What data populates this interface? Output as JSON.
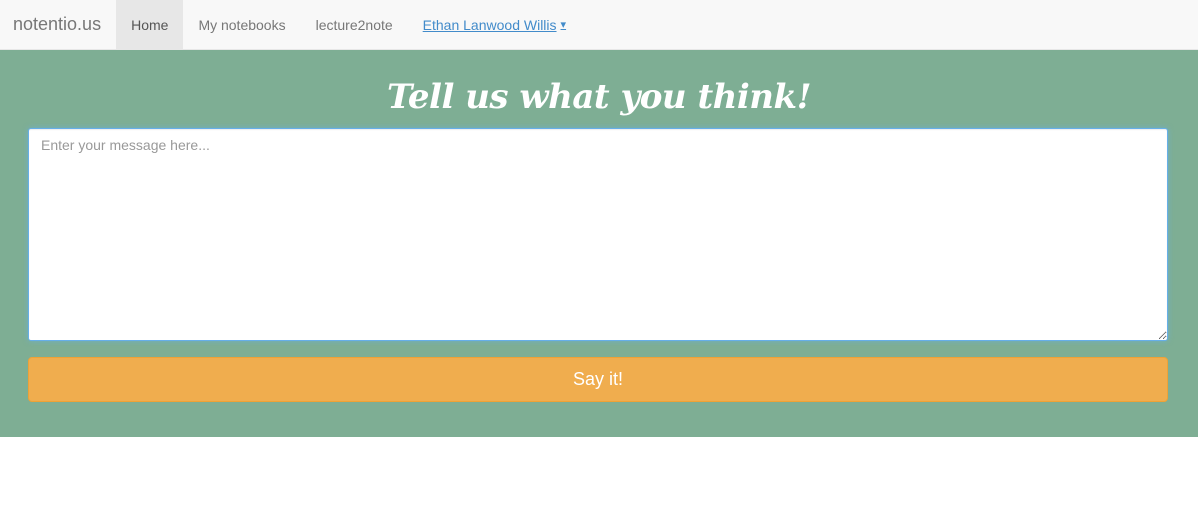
{
  "navbar": {
    "brand": "notentio.us",
    "items": [
      {
        "label": "Home",
        "active": true
      },
      {
        "label": "My notebooks",
        "active": false
      },
      {
        "label": "lecture2note",
        "active": false
      }
    ],
    "user": {
      "label": "Ethan Lanwood Willis",
      "caret": "▾"
    }
  },
  "hero": {
    "title": "Tell us what you think!",
    "message_placeholder": "Enter your message here...",
    "message_value": "",
    "submit_label": "Say it!"
  },
  "colors": {
    "hero_bg": "#7eae94",
    "button_bg": "#f0ad4e",
    "navbar_bg": "#f8f8f8",
    "link": "#428bca"
  }
}
